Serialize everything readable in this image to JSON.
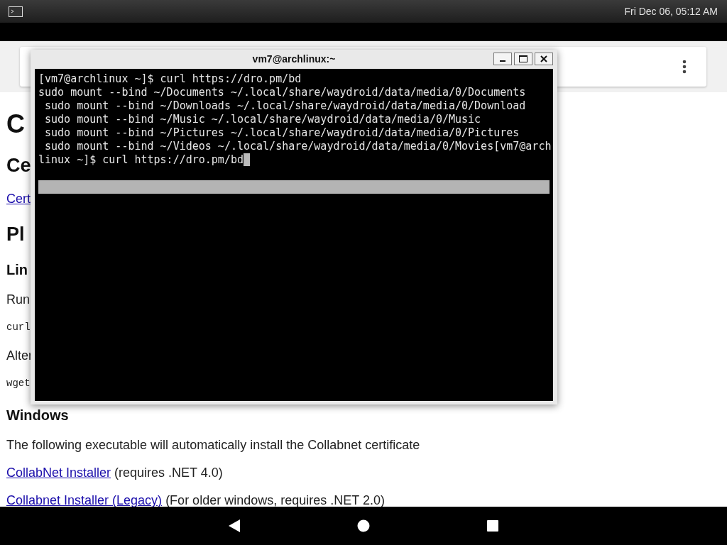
{
  "status_bar": {
    "clock": "Fri Dec 06, 05:12 AM"
  },
  "page": {
    "blocks": [
      {
        "kind": "h1",
        "text": "C"
      },
      {
        "kind": "h2",
        "text": "Ce"
      },
      {
        "kind": "link",
        "text": "Cert"
      },
      {
        "kind": "h2",
        "text": "Pl"
      },
      {
        "kind": "h3",
        "text": "Lin"
      },
      {
        "kind": "p",
        "text": "Run"
      },
      {
        "kind": "code",
        "text": "curl"
      },
      {
        "kind": "p",
        "text": "Alter"
      },
      {
        "kind": "code",
        "text": "wget"
      },
      {
        "kind": "h3",
        "text": "Windows"
      },
      {
        "kind": "p",
        "text": "The following executable will automatically install the Collabnet certificate"
      },
      {
        "kind": "link",
        "text": "CollabNet Installer",
        "suffix": " (requires .NET 4.0)"
      },
      {
        "kind": "link",
        "text": "Collabnet Installer (Legacy)",
        "suffix": " (For older windows, requires .NET 2.0)"
      }
    ]
  },
  "terminal": {
    "title": "vm7@archlinux:~",
    "lines": [
      "[vm7@archlinux ~]$ curl https://dro.pm/bd",
      "sudo mount --bind ~/Documents ~/.local/share/waydroid/data/media/0/Documents",
      " sudo mount --bind ~/Downloads ~/.local/share/waydroid/data/media/0/Download",
      " sudo mount --bind ~/Music ~/.local/share/waydroid/data/media/0/Music",
      " sudo mount --bind ~/Pictures ~/.local/share/waydroid/data/media/0/Pictures",
      " sudo mount --bind ~/Videos ~/.local/share/waydroid/data/media/0/Movies[vm7@arch",
      "linux ~]$ curl https://dro.pm/bd"
    ]
  }
}
